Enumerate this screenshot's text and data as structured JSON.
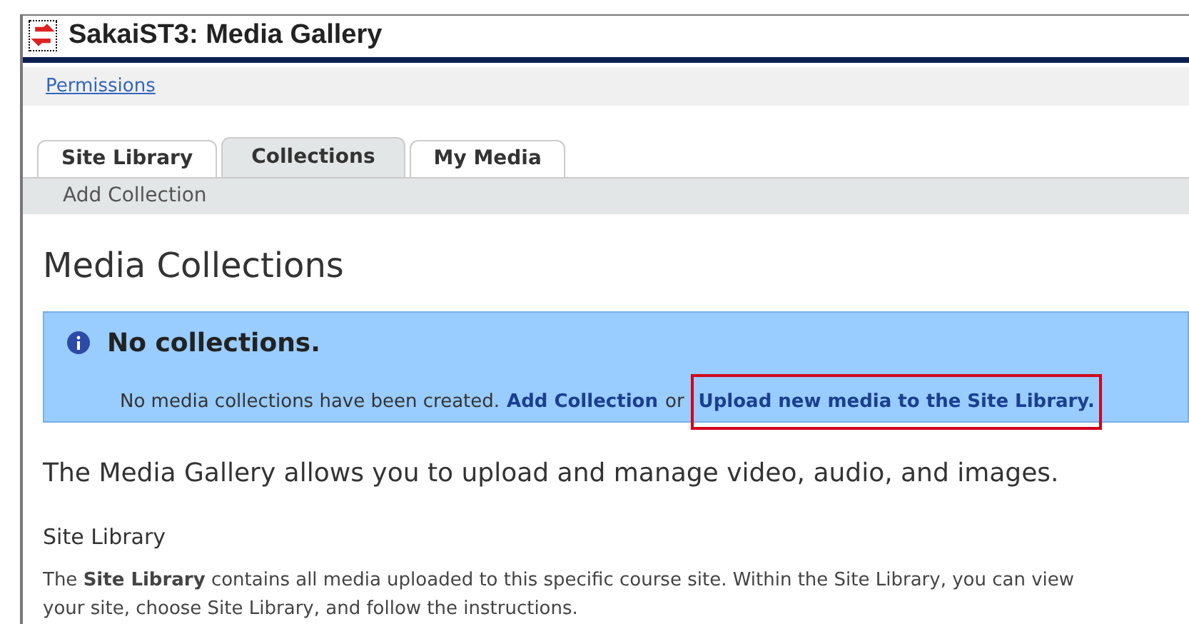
{
  "window": {
    "title": "SakaiST3: Media Gallery"
  },
  "toolbar": {
    "links": [
      "Permissions"
    ]
  },
  "tabs": [
    {
      "label": "Site Library",
      "selected": false
    },
    {
      "label": "Collections",
      "selected": true
    },
    {
      "label": "My Media",
      "selected": false
    }
  ],
  "subnav": {
    "links": [
      "Add Collection"
    ]
  },
  "heading": "Media Collections",
  "alert": {
    "title": "No collections.",
    "message": "No media collections have been created.",
    "links": [
      {
        "label": "Add Collection",
        "highlighted": false
      },
      {
        "label": "Upload new media to the Site Library.",
        "highlighted": true
      }
    ],
    "joiner": "or"
  },
  "intro": "The Media Gallery allows you to upload and manage video, audio, and images.",
  "section": {
    "title": "Site Library",
    "lines": [
      "The **Site Library** contains all media uploaded to this specific course site. Within the Site Library, you can view",
      "your site, choose Site Library, and follow the instructions."
    ]
  }
}
